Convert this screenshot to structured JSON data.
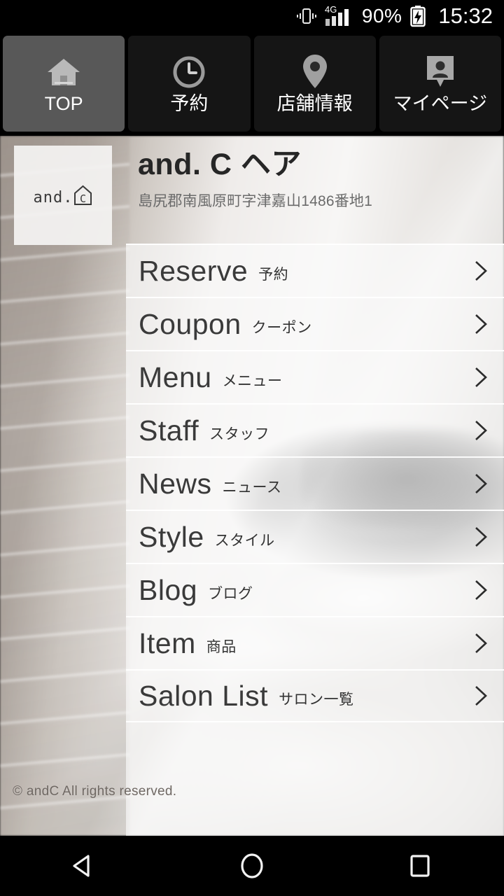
{
  "status_bar": {
    "vibrate_icon": "vibrate-icon",
    "network_label": "4G",
    "signal_icon": "signal-bars-icon",
    "battery_percent": "90%",
    "battery_icon": "battery-charging-icon",
    "time": "15:32"
  },
  "tabs": [
    {
      "label": "TOP",
      "icon": "home-icon",
      "active": true
    },
    {
      "label": "予約",
      "icon": "clock-icon",
      "active": false
    },
    {
      "label": "店舗情報",
      "icon": "map-pin-icon",
      "active": false
    },
    {
      "label": "マイページ",
      "icon": "account-card-icon",
      "active": false
    }
  ],
  "header": {
    "logo_text": "and.",
    "logo_mark_letter": "C",
    "logo_mark_icon": "house-outline-icon",
    "title": "and. C ヘア",
    "address": "島尻郡南風原町字津嘉山1486番地1"
  },
  "menu": [
    {
      "en": "Reserve",
      "ja": "予約",
      "chevron": "chevron-right-icon"
    },
    {
      "en": "Coupon",
      "ja": "クーポン",
      "chevron": "chevron-right-icon"
    },
    {
      "en": "Menu",
      "ja": "メニュー",
      "chevron": "chevron-right-icon"
    },
    {
      "en": "Staff",
      "ja": "スタッフ",
      "chevron": "chevron-right-icon"
    },
    {
      "en": "News",
      "ja": "ニュース",
      "chevron": "chevron-right-icon"
    },
    {
      "en": "Style",
      "ja": "スタイル",
      "chevron": "chevron-right-icon"
    },
    {
      "en": "Blog",
      "ja": "ブログ",
      "chevron": "chevron-right-icon"
    },
    {
      "en": "Item",
      "ja": "商品",
      "chevron": "chevron-right-icon"
    },
    {
      "en": "Salon List",
      "ja": "サロン一覧",
      "chevron": "chevron-right-icon"
    }
  ],
  "footer": {
    "copyright": "© andC All rights reserved."
  },
  "nav_bar": {
    "back": "back-triangle-icon",
    "home": "home-circle-icon",
    "recents": "recents-square-icon"
  },
  "colors": {
    "status_bar_bg": "#000000",
    "tab_bg": "#151515",
    "tab_active_bg": "#585858",
    "menu_panel_bg": "#fafafa",
    "title_text": "#262626",
    "menu_text": "#3a3a3a",
    "address_text": "#6b6b6b"
  }
}
